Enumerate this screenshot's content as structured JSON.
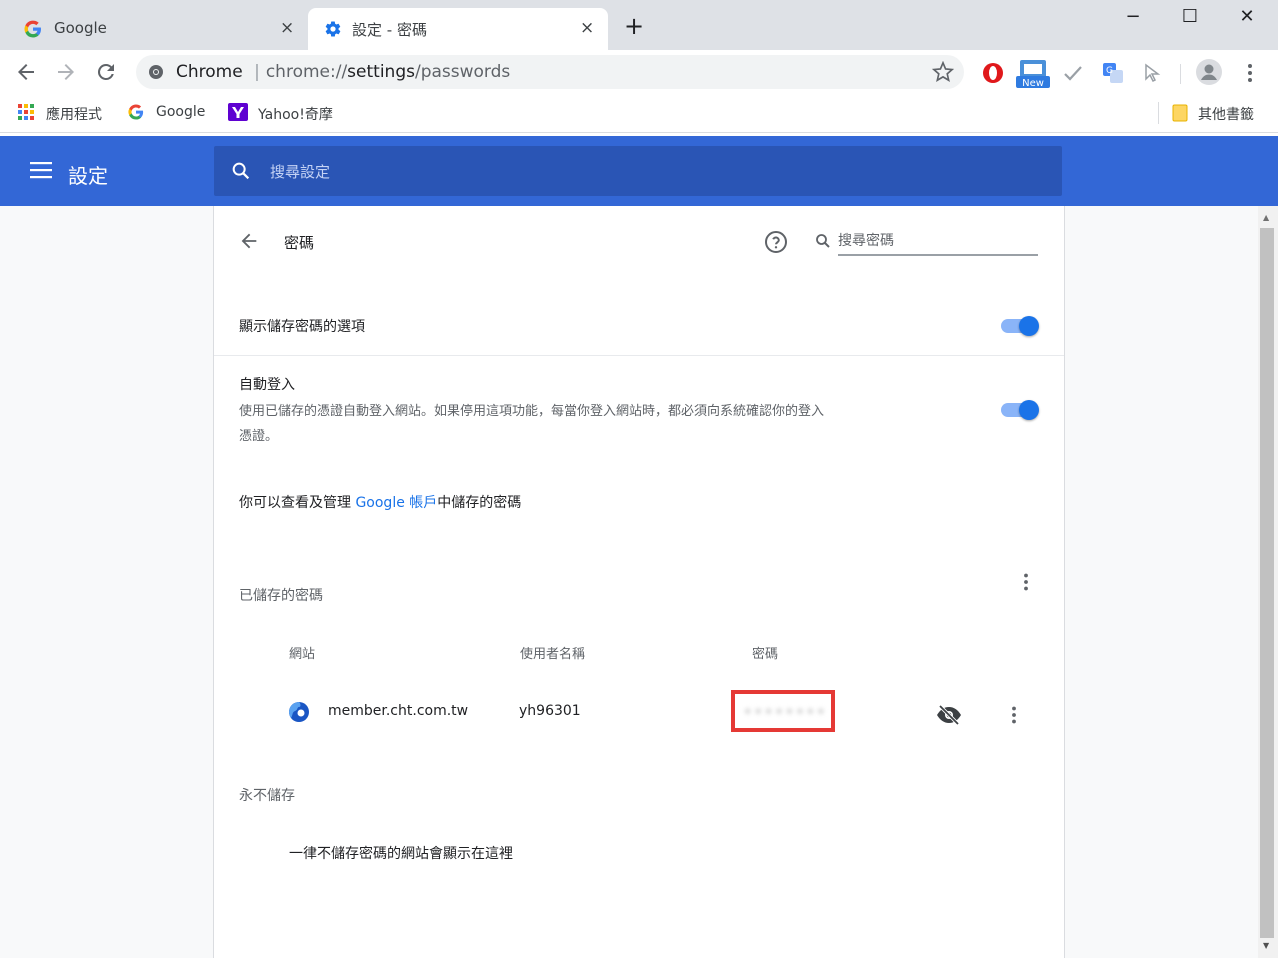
{
  "tabs": [
    {
      "title": "Google",
      "close": "×"
    },
    {
      "title": "設定 - 密碼",
      "close": "×"
    }
  ],
  "new_tab": "+",
  "window_controls": {
    "minimize": "−",
    "maximize": "☐",
    "close": "✕"
  },
  "omnibox": {
    "label": "Chrome",
    "separator": "|",
    "url_scheme": "chrome://",
    "url_host": "settings",
    "url_path": "/passwords"
  },
  "bookmarks": [
    {
      "label": "應用程式",
      "icon": "apps-grid-icon"
    },
    {
      "label": "Google",
      "icon": "google-g-icon"
    },
    {
      "label": "Yahoo!奇摩",
      "icon": "yahoo-icon"
    }
  ],
  "other_bookmarks": "其他書籤",
  "settings": {
    "title": "設定",
    "search_placeholder": "搜尋設定"
  },
  "passwords": {
    "page_title": "密碼",
    "search_placeholder": "搜尋密碼",
    "offer_save": {
      "label": "顯示儲存密碼的選項",
      "enabled": true
    },
    "auto_signin": {
      "label": "自動登入",
      "description_line1": "使用已儲存的憑證自動登入網站。如果停用這項功能，每當你登入網站時，都必須向系統確認你的登入",
      "description_line2": "憑證。",
      "enabled": true
    },
    "account_prefix": "你可以查看及管理",
    "account_link": "Google 帳戶",
    "account_suffix": "中儲存的密碼",
    "saved_heading": "已儲存的密碼",
    "columns": {
      "site": "網站",
      "username": "使用者名稱",
      "password": "密碼"
    },
    "entries": [
      {
        "site": "member.cht.com.tw",
        "username": "yh96301",
        "password": "••••••••"
      }
    ],
    "never_heading": "永不儲存",
    "never_empty": "一律不儲存密碼的網站會顯示在這裡"
  },
  "colors": {
    "accent": "#3367d6",
    "toggle_on": "#1a73e8",
    "link": "#1a73e8",
    "highlight_box": "#e53935"
  }
}
